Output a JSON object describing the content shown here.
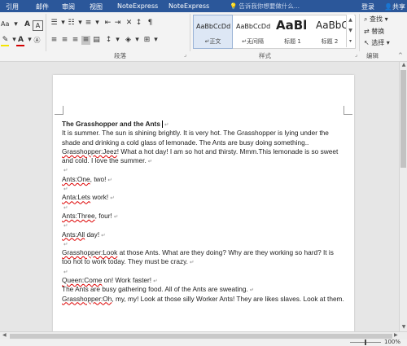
{
  "tabs": [
    "引用",
    "邮件",
    "审阅",
    "视图",
    "NoteExpress",
    "NoteExpress"
  ],
  "tell_me": "告诉我你想要做什么...",
  "account": {
    "login": "登录",
    "share": "共享"
  },
  "ribbon": {
    "font_size_label": "Aa",
    "groups": {
      "paragraph": "段落",
      "styles": "样式",
      "editing": "编辑"
    },
    "styles": [
      {
        "preview": "AaBbCcDd",
        "name": "正文"
      },
      {
        "preview": "AaBbCcDd",
        "name": "无间隔"
      },
      {
        "preview": "AaBl",
        "name": "标题 1"
      },
      {
        "preview": "AaBbC",
        "name": "标题 2"
      }
    ],
    "editing": {
      "find": "查找",
      "replace": "替换",
      "select": "选择"
    },
    "colors": {
      "highlight": "#f5e400",
      "font_color": "#d40000"
    }
  },
  "document": {
    "title": "The Grasshopper and the Ants",
    "lines": [
      "It is summer. The sun is shining brightly. It is very hot. The Grasshopper is lying under the",
      "shade and drinking a cold glass of lemonade. The Ants are busy doing something..",
      "Grasshopper:Jeez! What a hot day! I am so hot and thirsty. Mmm.This lemonade is so sweet",
      "and cold. I love the summer.",
      "",
      "Ants:One, two!",
      "",
      "Anta:Lets work!",
      "",
      "Ants:Three, four!",
      "",
      "Ants:All day!",
      "",
      "Grasshopper:Look at those Ants. What are they doing? Why are they working so hard? It is",
      "too hot to work today. They must be crazy.",
      "",
      "Queen:Come on! Work faster!",
      "   The Ants are busy gathering food. All of the Ants are sweating.",
      "Grasshopper:Oh, my, my! Look at those silly Worker Ants! They are likes slaves. Look at them."
    ]
  },
  "status": {
    "zoom": "100%"
  }
}
